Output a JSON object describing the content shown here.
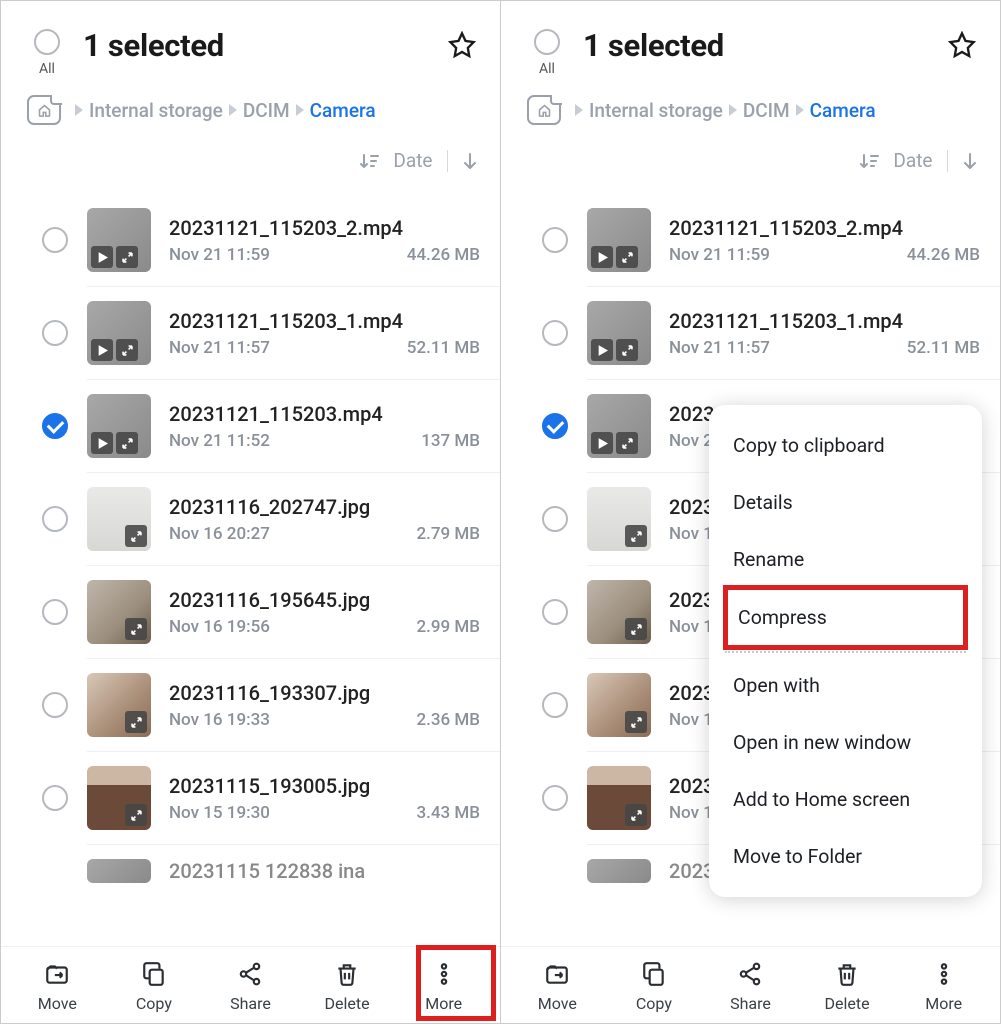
{
  "header": {
    "title": "1 selected",
    "all_label": "All"
  },
  "breadcrumb": {
    "items": [
      "Internal storage",
      "DCIM",
      "Camera"
    ],
    "active_index": 2
  },
  "sort": {
    "label": "Date"
  },
  "files": [
    {
      "name": "20231121_115203_2.mp4",
      "date": "Nov 21 11:59",
      "size": "44.26 MB",
      "selected": false,
      "video": true,
      "thumb": "vid"
    },
    {
      "name": "20231121_115203_1.mp4",
      "date": "Nov 21 11:57",
      "size": "52.11 MB",
      "selected": false,
      "video": true,
      "thumb": "vid"
    },
    {
      "name": "20231121_115203.mp4",
      "date": "Nov 21 11:52",
      "size": "137 MB",
      "selected": true,
      "video": true,
      "thumb": "vid"
    },
    {
      "name": "20231116_202747.jpg",
      "date": "Nov 16 20:27",
      "size": "2.79 MB",
      "selected": false,
      "video": false,
      "thumb": "jpg1"
    },
    {
      "name": "20231116_195645.jpg",
      "date": "Nov 16 19:56",
      "size": "2.99 MB",
      "selected": false,
      "video": false,
      "thumb": "jpg2"
    },
    {
      "name": "20231116_193307.jpg",
      "date": "Nov 16 19:33",
      "size": "2.36 MB",
      "selected": false,
      "video": false,
      "thumb": "jpg3"
    },
    {
      "name": "20231115_193005.jpg",
      "date": "Nov 15 19:30",
      "size": "3.43 MB",
      "selected": false,
      "video": false,
      "thumb": "jpg4"
    }
  ],
  "partial_file": {
    "name": "20231115_122838.jpg",
    "name_display": "20231115  122838 ina"
  },
  "bottom": {
    "move": "Move",
    "copy": "Copy",
    "share": "Share",
    "delete": "Delete",
    "more": "More"
  },
  "menu": {
    "copy_clipboard": "Copy to clipboard",
    "details": "Details",
    "rename": "Rename",
    "compress": "Compress",
    "open_with": "Open with",
    "open_new_window": "Open in new window",
    "add_home": "Add to Home screen",
    "move_folder": "Move to Folder"
  }
}
